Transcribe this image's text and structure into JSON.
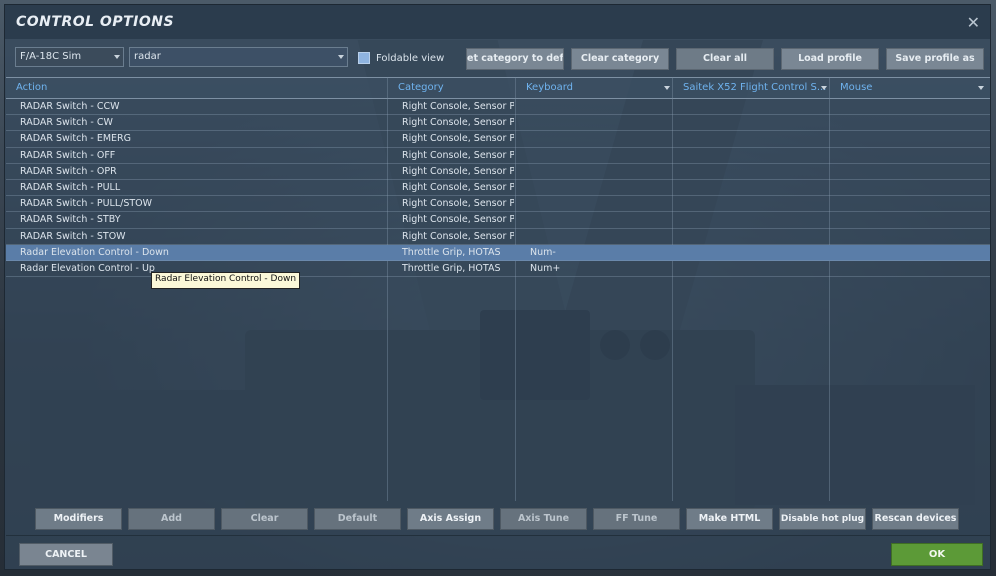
{
  "window": {
    "title": "CONTROL OPTIONS",
    "close_glyph": "✕"
  },
  "toolbar": {
    "aircraft_select": "F/A-18C Sim",
    "search_value": "radar",
    "foldable_label": "Foldable view",
    "foldable_checked": true,
    "buttons": [
      "et category to defa",
      "Clear category",
      "Clear all",
      "Load profile",
      "Save profile as"
    ]
  },
  "table": {
    "columns": [
      "Action",
      "Category",
      "Keyboard",
      "Saitek X52 Flight Control S...",
      "Mouse"
    ],
    "rows": [
      {
        "action": "RADAR Switch - CCW",
        "category": "Right Console, Sensor Pan",
        "keyboard": "",
        "selected": false
      },
      {
        "action": "RADAR Switch - CW",
        "category": "Right Console, Sensor Pan",
        "keyboard": "",
        "selected": false
      },
      {
        "action": "RADAR Switch - EMERG",
        "category": "Right Console, Sensor Pan",
        "keyboard": "",
        "selected": false
      },
      {
        "action": "RADAR Switch - OFF",
        "category": "Right Console, Sensor Pan",
        "keyboard": "",
        "selected": false
      },
      {
        "action": "RADAR Switch - OPR",
        "category": "Right Console, Sensor Pan",
        "keyboard": "",
        "selected": false
      },
      {
        "action": "RADAR Switch - PULL",
        "category": "Right Console, Sensor Pan",
        "keyboard": "",
        "selected": false
      },
      {
        "action": "RADAR Switch - PULL/STOW",
        "category": "Right Console, Sensor Pan",
        "keyboard": "",
        "selected": false
      },
      {
        "action": "RADAR Switch - STBY",
        "category": "Right Console, Sensor Pan",
        "keyboard": "",
        "selected": false
      },
      {
        "action": "RADAR Switch - STOW",
        "category": "Right Console, Sensor Pan",
        "keyboard": "",
        "selected": false
      },
      {
        "action": "Radar Elevation Control - Down",
        "category": "Throttle Grip, HOTAS",
        "keyboard": "Num-",
        "selected": true
      },
      {
        "action": "Radar Elevation Control - Up",
        "category": "Throttle Grip, HOTAS",
        "keyboard": "Num+",
        "selected": false
      }
    ],
    "tooltip": "Radar Elevation Control - Down"
  },
  "bottom_buttons": [
    {
      "label": "Modifiers",
      "enabled": true
    },
    {
      "label": "Add",
      "enabled": false
    },
    {
      "label": "Clear",
      "enabled": false
    },
    {
      "label": "Default",
      "enabled": false
    },
    {
      "label": "Axis Assign",
      "enabled": true
    },
    {
      "label": "Axis Tune",
      "enabled": false
    },
    {
      "label": "FF Tune",
      "enabled": false
    },
    {
      "label": "Make HTML",
      "enabled": true
    },
    {
      "label": "Disable hot plug",
      "enabled": true
    },
    {
      "label": "Rescan devices",
      "enabled": true
    }
  ],
  "footer": {
    "cancel_label": "CANCEL",
    "ok_label": "OK"
  },
  "colors": {
    "accent_header": "#6fb3ef",
    "selected_row": "#5a7da8",
    "ok_green": "#5c9a37"
  }
}
